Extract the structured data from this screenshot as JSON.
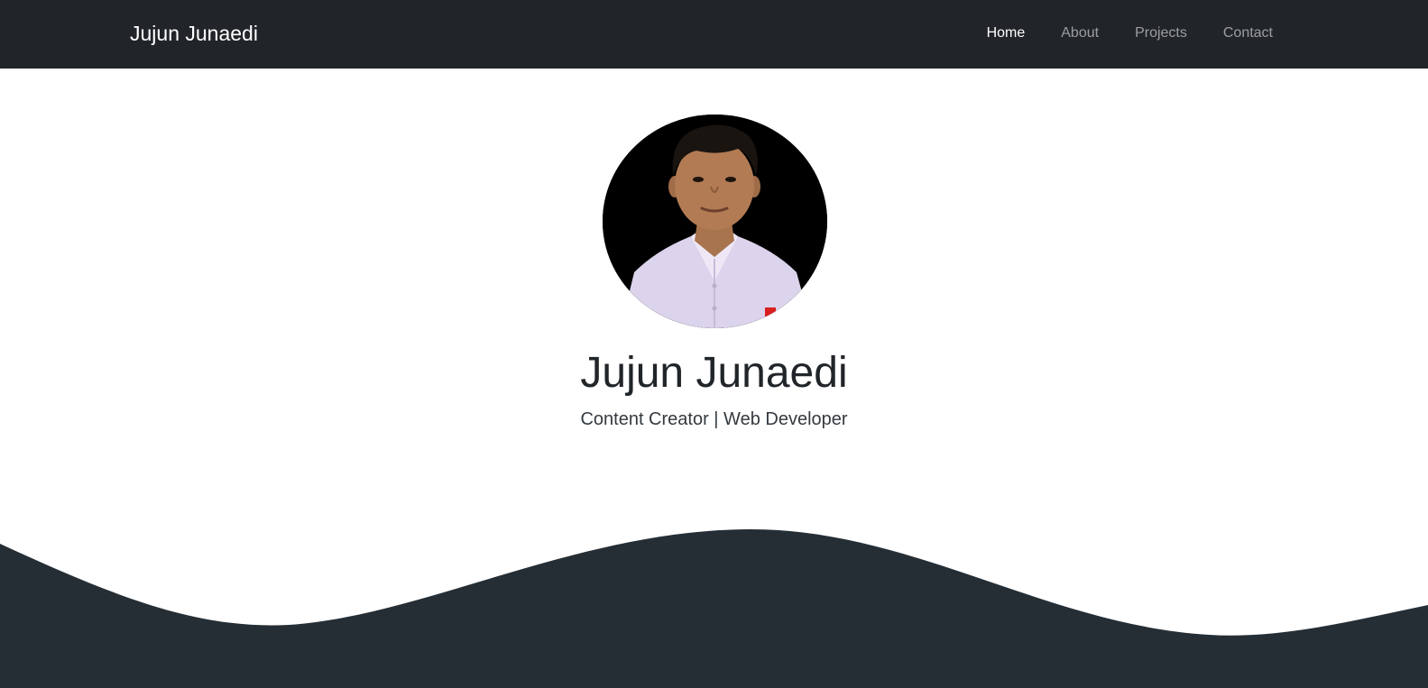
{
  "navbar": {
    "brand": "Jujun Junaedi",
    "links": [
      {
        "label": "Home",
        "active": true
      },
      {
        "label": "About",
        "active": false
      },
      {
        "label": "Projects",
        "active": false
      },
      {
        "label": "Contact",
        "active": false
      }
    ]
  },
  "hero": {
    "name": "Jujun Junaedi",
    "tagline": "Content Creator | Web Developer"
  },
  "colors": {
    "navbar_bg": "#212529",
    "wave_fill": "#252e35",
    "text_dark": "#212529",
    "nav_active": "#ffffff",
    "nav_inactive": "#9a9da0"
  }
}
